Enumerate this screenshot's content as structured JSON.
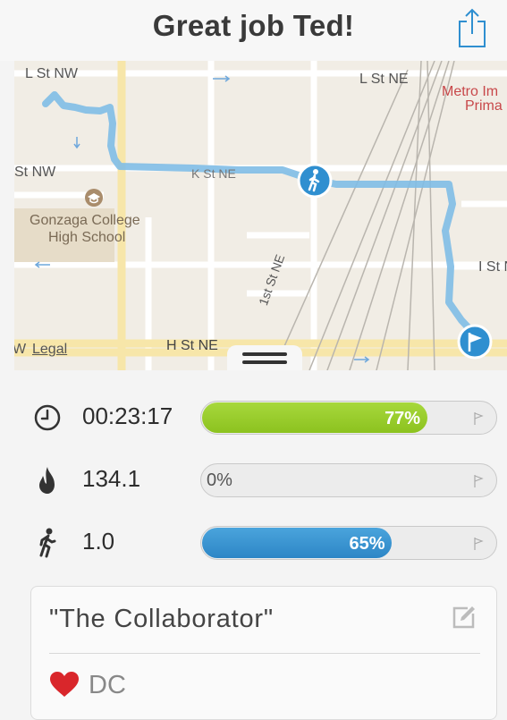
{
  "header": {
    "title": "Great job Ted!",
    "share_icon": "share-icon"
  },
  "map": {
    "street_labels": {
      "l_st_nw": "L St NW",
      "l_st_ne": "L St NE",
      "st_nw": "St NW",
      "k_st_ne": "K St NE",
      "first_st_ne": "1st St NE",
      "h_st_ne": "H St NE",
      "i_st": "I St N",
      "w": "W",
      "poi_school_line1": "Gonzaga College",
      "poi_school_line2": "High School",
      "poi_metro_line1": "Metro Im",
      "poi_metro_line2": "Prima"
    },
    "legal_link": "Legal",
    "route_color": "#6db6e0",
    "marker_color": "#2f8fd0"
  },
  "stats": {
    "time": {
      "value": "00:23:17",
      "percent_label": "77%",
      "progress": 0.77,
      "icon": "clock-icon",
      "color": "#8cc21f"
    },
    "calories": {
      "value": "134.1",
      "percent_label": "0%",
      "progress": 0.0,
      "icon": "flame-icon"
    },
    "distance": {
      "value": "1.0",
      "percent_label": "65%",
      "progress": 0.65,
      "icon": "walker-icon",
      "color": "#2d86c6"
    }
  },
  "card": {
    "title": "\"The Collaborator\"",
    "tag": "DC",
    "heart_color": "#d9262b"
  }
}
